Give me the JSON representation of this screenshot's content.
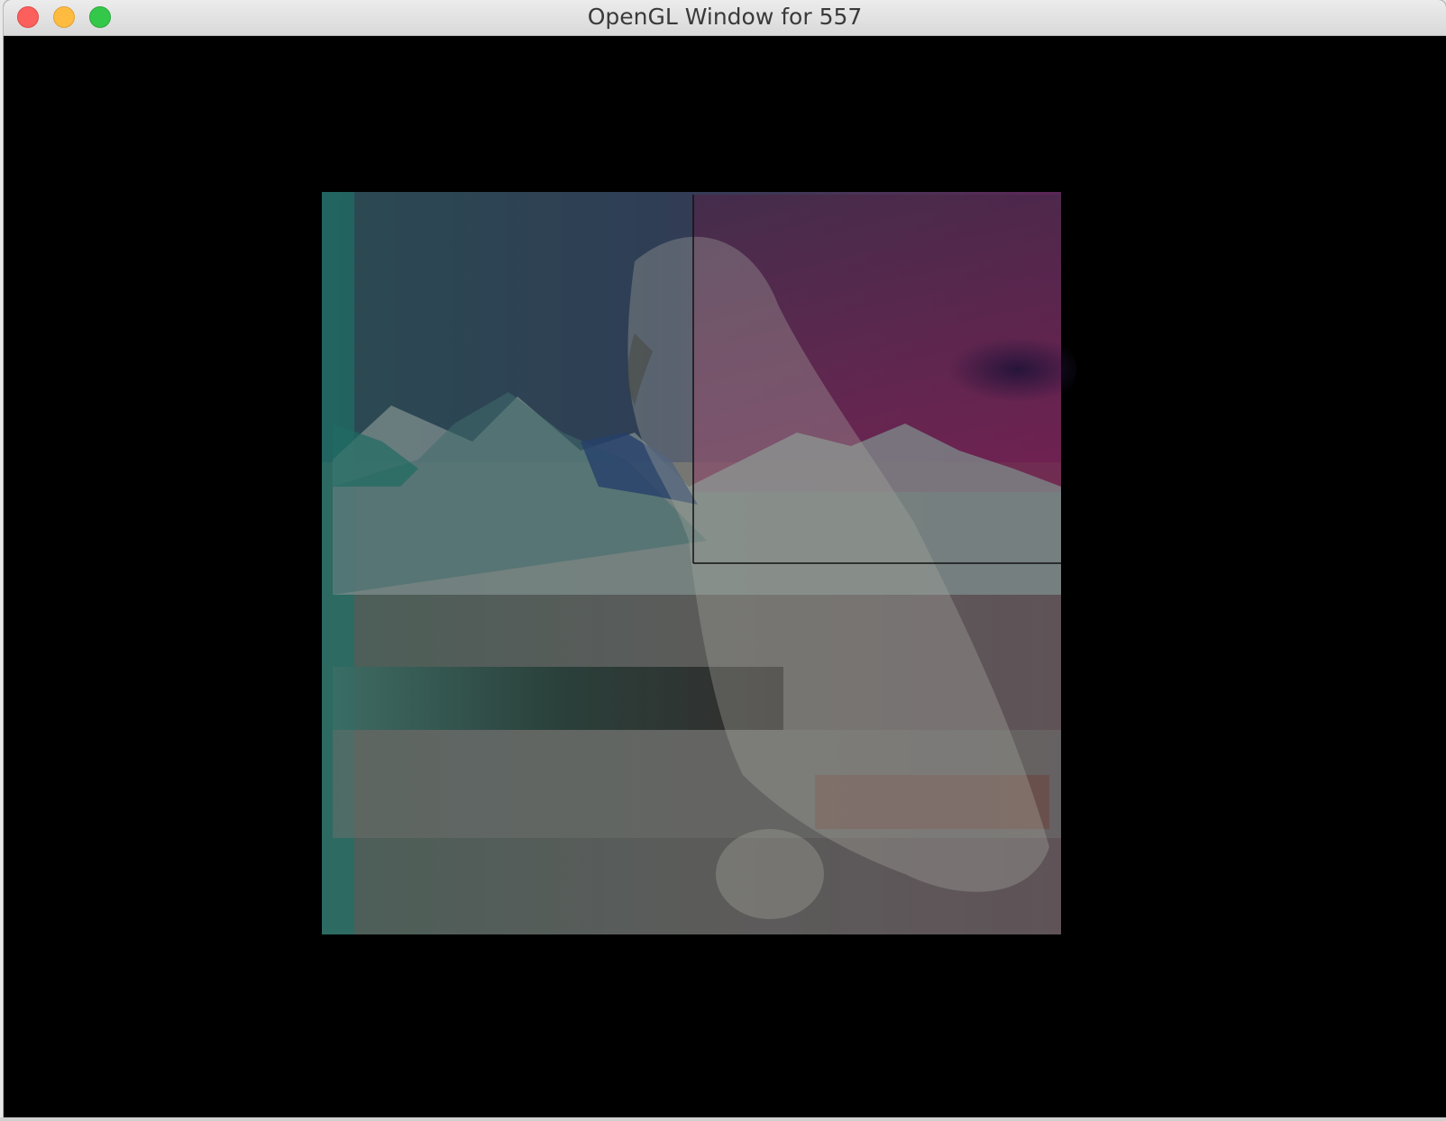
{
  "window": {
    "title": "OpenGL Window for 557",
    "buttons": {
      "close": "close-button",
      "minimize": "minimize-button",
      "zoom": "zoom-button"
    }
  },
  "scene": {
    "description_icon": "rendered-texture-quad",
    "colors": {
      "background": "#000000",
      "teal_tint": "#2f6d66",
      "magenta_tint": "#6a2a5a",
      "purple_sky": "#4a2a5a",
      "pale_overlay": "#a8a8a0"
    }
  }
}
